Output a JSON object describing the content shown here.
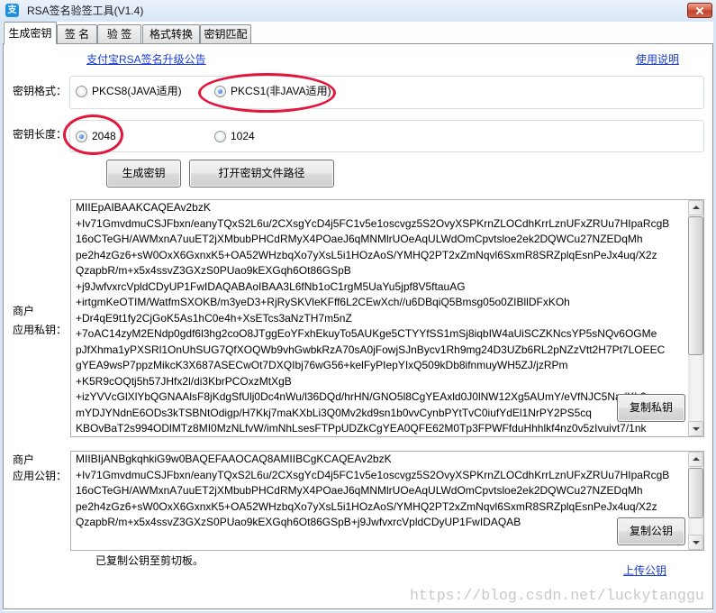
{
  "window": {
    "title": "RSA签名验签工具(V1.4)",
    "app_icon": "alipay-icon",
    "app_icon_glyph": "支",
    "close_icon": "close-icon"
  },
  "tabs": [
    {
      "label": "生成密钥",
      "active": true
    },
    {
      "label": "签 名",
      "active": false
    },
    {
      "label": "验 签",
      "active": false
    },
    {
      "label": "格式转换",
      "active": false
    },
    {
      "label": "密钥匹配",
      "active": false
    }
  ],
  "links": {
    "announcement": "支付宝RSA签名升级公告",
    "help": "使用说明",
    "upload_public_key": "上传公钥"
  },
  "key_format": {
    "label": "密钥格式：",
    "options": [
      {
        "label": "PKCS8(JAVA适用)",
        "checked": false
      },
      {
        "label": "PKCS1(非JAVA适用)",
        "checked": true
      }
    ]
  },
  "key_length": {
    "label": "密钥长度：",
    "options": [
      {
        "label": "2048",
        "checked": true
      },
      {
        "label": "1024",
        "checked": false
      }
    ]
  },
  "buttons": {
    "generate_keys": "生成密钥",
    "open_key_path": "打开密钥文件路径",
    "copy_private_key": "复制私钥",
    "copy_public_key": "复制公钥"
  },
  "private_key": {
    "label_line1": "商户",
    "label_line2": "应用私钥：",
    "lines": [
      "MIIEpAIBAAKCAQEAv2bzK",
      "+Iv71GmvdmuCSJFbxn/eanyTQxS2L6u/2CXsgYcD4j5FC1v5e1oscvgz5S2OvyXSPKrnZLOCdhKrrLznUFxZRUu7HIpaRcgB",
      "16oCTeGH/AWMxnA7uuET2jXMbubPHCdRMyX4POaeJ6qMNMlrUOeAqULWdOmCpvtsloe2ek2DQWCu27NZEDqMh",
      "pe2h4zGz6+sW0OxX6GxnxK5+OA52WHzbqXo7yXsL5i1HOzAoS/YMHQ2PT2xZmNqvl6SxmR8SRZplqEsnPeJx4uq/X2z",
      "QzapbR/m+x5x4ssvZ3GXzS0PUao9kEXGqh6Ot86GSpB",
      "+j9JwfvxrcVpldCDyUP1FwIDAQABAoIBAA3L6fNb1oC1rgM5UaYu5jpf8V5ftauAG",
      "+irtgmKeOTIM/WatfmSXOKB/m3yeD3+RjRySKVleKFff6L2CEwXch//u6DBqiQ5Bmsg05o0ZIBllDFxKOh",
      "+Dr4qE9t1fy2CjGoK5As1hC0e4h+XsETcs3aNzTH7m5nZ",
      "+7oAC14zyM2ENdp0gdf6l3hg2coO8JTggEoYFxhEkuyTo5AUKge5CTYYfSS1mSj8iqbIW4aUiSCZKNcsYP5sNQv6OGMe",
      "pJfXhma1yPXSRl1OnUhSUG7QfXOQWb9vhGwbkRzA70sA0jFowjSJnBycv1Rh9mg24D3UZb6RL2pNZzVtt2H7Pt7LOEEC",
      "gYEA9wsP7ppzMikcK3X687ASECwOt7DXQIbj76wG56+kelFyPIepYIxQ509kDb8ifnmuyWH5ZJ/jzRPm",
      "+K5R9cOQtj5h57JHfx2l/di3KbrPCOxzMtXgB",
      "+izYVVcGlXlYbQGNAAlsF8jKdgSfUlj0Dc4nWu/l36DQd/hrHN/GNO5l8CgYEAxld0J0lNW12Xg5AUmY/eVfNJC5NadKh2",
      "mYDJYNdnE6ODs3kTSBNtOdigp/H7Kkj7maKXbLi3Q0Mv2kd9sn1b0vvCynbPYtTvC0iufYdEl1NrPY2PS5cq",
      "KBOvBaT2s994ODlMTz8MI0MzNLfvW/imNhLsesFTPpUDZkCgYEA0QFE62M0Tp3FPWFfduHhhlkf4nz0v5zIvuivt7/1nk"
    ]
  },
  "public_key": {
    "label_line1": "商户",
    "label_line2": "应用公钥：",
    "lines": [
      "MIIBIjANBgkqhkiG9w0BAQEFAAOCAQ8AMIIBCgKCAQEAv2bzK",
      "+Iv71GmvdmuCSJFbxn/eanyTQxS2L6u/2CXsgYcD4j5FC1v5e1oscvgz5S2OvyXSPKrnZLOCdhKrrLznUFxZRUu7HIpaRcgB",
      "16oCTeGH/AWMxnA7uuET2jXMbubPHCdRMyX4POaeJ6qMNMlrUOeAqULWdOmCpvtsloe2ek2DQWCu27NZEDqMh",
      "pe2h4zGz6+sW0OxX6GxnxK5+OA52WHzbqXo7yXsL5i1HOzAoS/YMHQ2PT2xZmNqvl6SxmR8SRZplqEsnPeJx4uq/X2z",
      "QzapbR/m+x5x4ssvZ3GXzS0PUao9kEXGqh6Ot86GSpB+j9JwfvxrcVpldCDyUP1FwIDAQAB"
    ]
  },
  "status_message": "已复制公钥至剪切板。",
  "watermark": "https://blog.csdn.net/luckytanggu",
  "colors": {
    "link": "#1a3ccf",
    "highlight": "#e3173b",
    "radio_dot": "#1e63c9",
    "watermark": "#c8c8c8",
    "title_bar": "#d8e6f5"
  }
}
